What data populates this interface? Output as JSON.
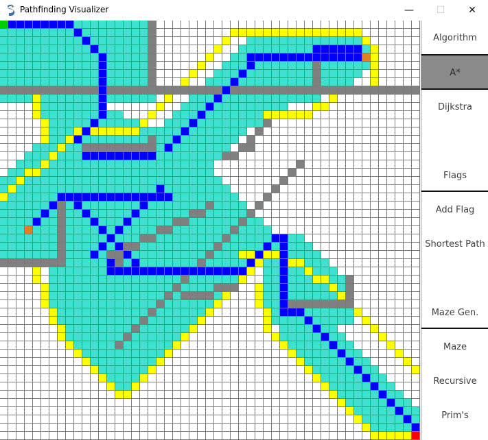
{
  "window": {
    "title": "Pathfinding Visualizer",
    "controls": {
      "minimize": "—",
      "maximize": "☐",
      "close": "✕"
    }
  },
  "grid": {
    "cols": 51,
    "rows": 51,
    "palette": {
      "empty": "#ffffff",
      "wall": "#808080",
      "visited": "#40e0d0",
      "frontier": "#ffff00",
      "path": "#0000ff",
      "start": "#00cc00",
      "end": "#ff0000",
      "flag": "#e08020"
    },
    "start_cell": [
      0,
      0
    ],
    "end_cell": [
      50,
      50
    ],
    "flag_cells": [
      [
        44,
        4
      ],
      [
        3,
        25
      ]
    ]
  },
  "sidebar": {
    "sections": [
      {
        "header": "Algorithm",
        "items": [
          "A*",
          "Dijkstra"
        ],
        "selected": "A*"
      },
      {
        "header": "Flags",
        "items": [
          "Add Flag",
          "Shortest Path"
        ]
      },
      {
        "header": "Maze Gen.",
        "items": [
          "Maze",
          "Recursive",
          "Prim's"
        ]
      }
    ],
    "colors": {
      "selected_bg": "#8a8a8a",
      "text": "#404040",
      "divider": "#111111"
    }
  }
}
